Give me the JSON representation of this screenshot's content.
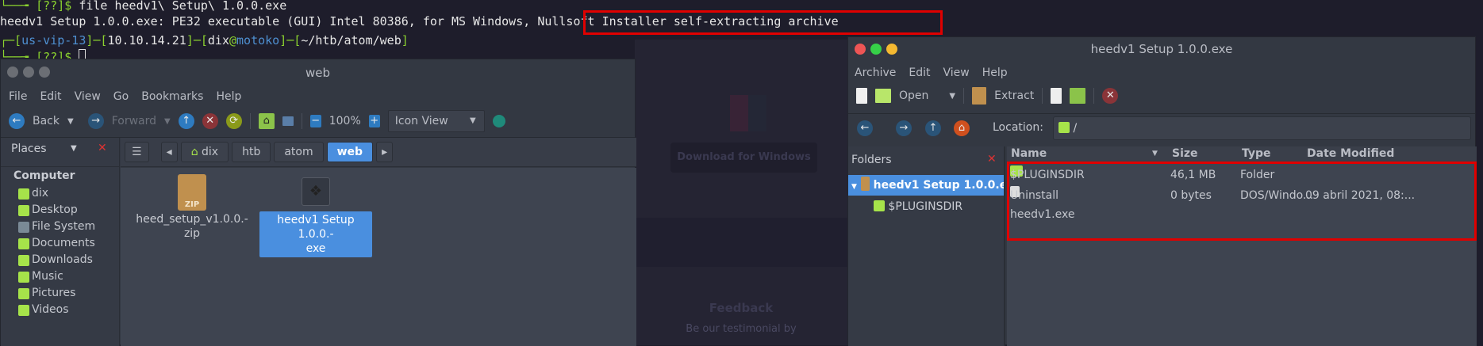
{
  "terminal": {
    "line1_prompt": "└──╼ [??]$ ",
    "line1_cmd": "file heedv1\\ Setup\\ 1.0.0.exe",
    "line2_a": "heedv1 Setup 1.0.0.exe: PE32 executable (GUI) Intel 80386, for MS Windows, ",
    "line2_b": "Nullsoft Installer self-extracting archive",
    "line3_vpn": "us-vip-13",
    "line3_ip": "10.10.14.21",
    "line3_user": "dix",
    "line3_host": "motoko",
    "line3_path": "~/htb/atom/web",
    "line4_prompt": "└──╼ [??]$ "
  },
  "background_site": {
    "button": "Download for Windows",
    "heading": "Feedback",
    "text": "Be our testimonial by"
  },
  "file_manager": {
    "title": "web",
    "menu": [
      "File",
      "Edit",
      "View",
      "Go",
      "Bookmarks",
      "Help"
    ],
    "toolbar": {
      "back": "Back",
      "forward": "Forward",
      "zoom": "100%",
      "view": "Icon View"
    },
    "places_label": "Places",
    "breadcrumbs": [
      "dix",
      "htb",
      "atom",
      "web"
    ],
    "sidebar_heading": "Computer",
    "sidebar": [
      "dix",
      "Desktop",
      "File System",
      "Documents",
      "Downloads",
      "Music",
      "Pictures",
      "Videos"
    ],
    "files": [
      {
        "name": "heed_setup_v1.0.0.-zip",
        "l1": "heed_setup_v1.0.0.-",
        "l2": "zip",
        "icon_text": "ZIP"
      },
      {
        "name": "heedv1 Setup 1.0.0.exe",
        "l1": "heedv1 Setup 1.0.0.-",
        "l2": "exe"
      }
    ]
  },
  "archive": {
    "title": "heedv1 Setup 1.0.0.exe",
    "menu": [
      "Archive",
      "Edit",
      "View",
      "Help"
    ],
    "toolbar": {
      "open": "Open",
      "extract": "Extract"
    },
    "location_label": "Location:",
    "location": "/",
    "folders_label": "Folders",
    "tree": [
      "heedv1 Setup 1.0.0.e...",
      "$PLUGINSDIR"
    ],
    "columns": [
      "Name",
      "Size",
      "Type",
      "Date Modified"
    ],
    "rows": [
      {
        "name": "$PLUGINSDIR",
        "size": "46,1 MB",
        "type": "Folder",
        "date": ""
      },
      {
        "name": "Uninstall heedv1.exe",
        "size": "0 bytes",
        "type": "DOS/Windo...",
        "date": "09 abril 2021, 08:..."
      }
    ]
  }
}
